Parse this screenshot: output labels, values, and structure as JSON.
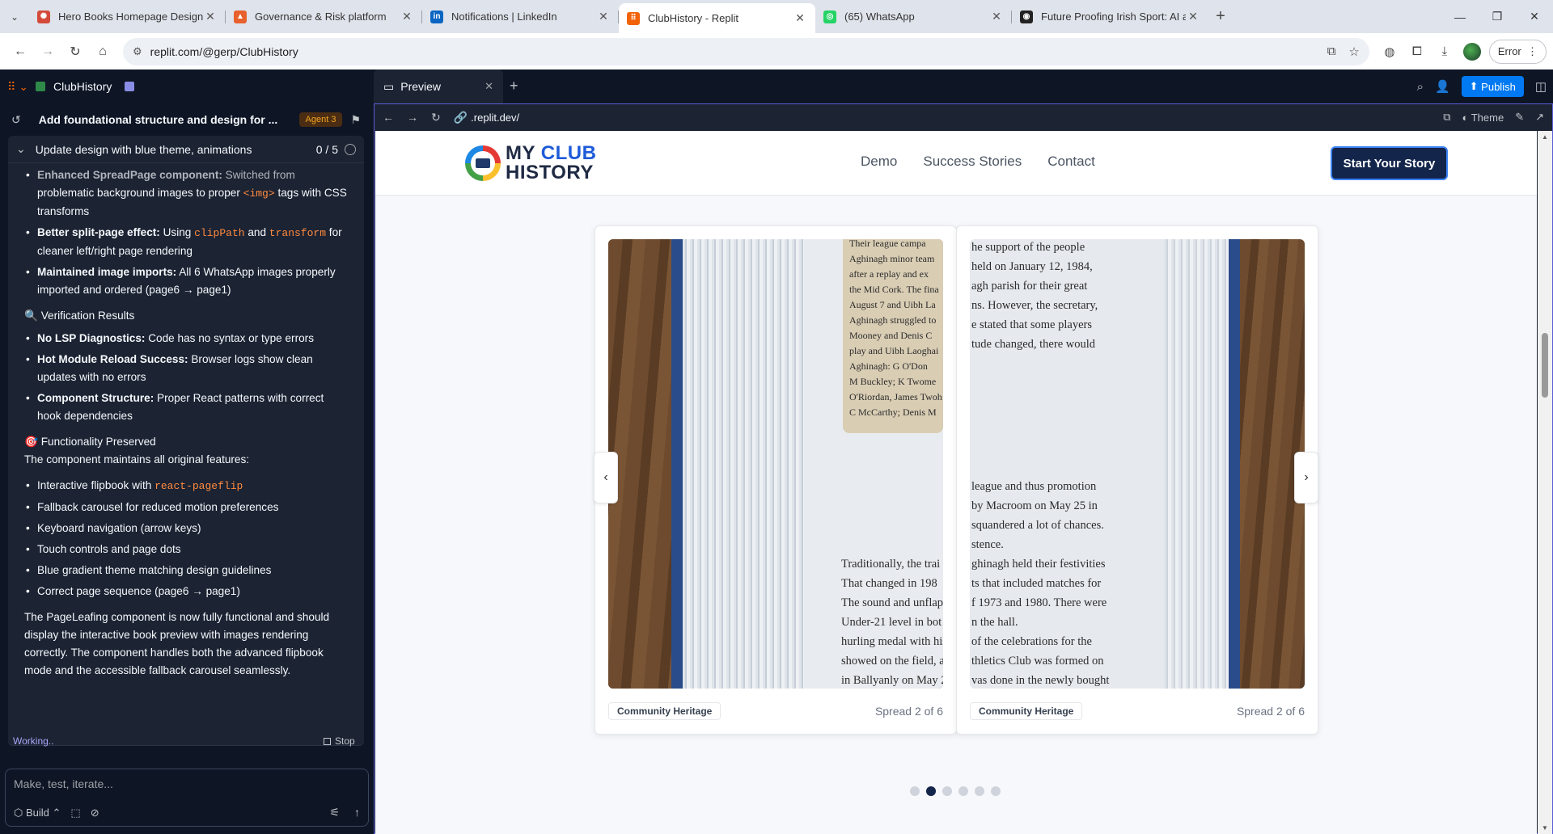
{
  "browser": {
    "tabs": [
      {
        "title": "Hero Books Homepage Design",
        "fav_color": "#d44a3a",
        "fav_glyph": "✺",
        "active": false
      },
      {
        "title": "Governance & Risk platform",
        "fav_color": "#e8612c",
        "fav_glyph": "▲",
        "active": false
      },
      {
        "title": "Notifications | LinkedIn",
        "fav_color": "#0a66c2",
        "fav_glyph": "in",
        "active": false
      },
      {
        "title": "ClubHistory - Replit",
        "fav_color": "#f26207",
        "fav_glyph": "⠿",
        "active": true
      },
      {
        "title": "(65) WhatsApp",
        "fav_color": "#25d366",
        "fav_glyph": "◎",
        "active": false
      },
      {
        "title": "Future Proofing Irish Sport: AI a",
        "fav_color": "#222222",
        "fav_glyph": "◉",
        "active": false
      }
    ],
    "url": "replit.com/@gerp/ClubHistory",
    "error_label": "Error"
  },
  "replit": {
    "project_name": "ClubHistory",
    "preview_tab": "Preview",
    "publish_label": "Publish",
    "agent": {
      "thread_title": "Add foundational structure and design for ...",
      "badge": "Agent 3",
      "task_title": "Update design with blue theme, animations",
      "task_count": "0 / 5",
      "messages": {
        "top_item_bold": "Enhanced SpreadPage component:",
        "top_item_text": " Switched from",
        "top_item_text2": "problematic background images to proper ",
        "top_item_code": "<img>",
        "top_item_text3": " tags with CSS transforms",
        "items1": [
          {
            "bold": "Better split-page effect:",
            "pre": " Using ",
            "code1": "clipPath",
            "mid": " and ",
            "code2": "transform",
            "post": " for cleaner left/right page rendering"
          },
          {
            "bold": "Maintained image imports:",
            "text": " All 6 WhatsApp images properly imported and ordered (page6 → page1)"
          }
        ],
        "verify_heading": "🔍 Verification Results",
        "items2": [
          {
            "bold": "No LSP Diagnostics:",
            "text": " Code has no syntax or type errors"
          },
          {
            "bold": "Hot Module Reload Success:",
            "text": " Browser logs show clean updates with no errors"
          },
          {
            "bold": "Component Structure:",
            "text": " Proper React patterns with correct hook dependencies"
          }
        ],
        "func_heading": "🎯 Functionality Preserved",
        "func_intro": "The component maintains all original features:",
        "feature_code_pre": "Interactive flipbook with ",
        "feature_code": "react-pageflip",
        "features": [
          "Fallback carousel for reduced motion preferences",
          "Keyboard navigation (arrow keys)",
          "Touch controls and page dots",
          "Blue gradient theme matching design guidelines",
          "Correct page sequence (page6 → page1)"
        ],
        "summary": "The PageLeafing component is now fully functional and should display the interactive book preview with images rendering correctly. The component handles both the advanced flipbook mode and the accessible fallback carousel seamlessly."
      },
      "status": "Working..",
      "stop_label": "Stop",
      "input_placeholder": "Make, test, iterate...",
      "build_label": "Build"
    },
    "preview": {
      "url": ".replit.dev/",
      "theme_label": "Theme"
    }
  },
  "site": {
    "logo": {
      "my": "MY",
      "club": "CLUB",
      "history": "HISTORY"
    },
    "nav": [
      "Demo",
      "Success Stories",
      "Contact"
    ],
    "cta": "Start Your Story",
    "left_card": {
      "tag": "Community Heritage",
      "spread": "Spread 2 of 6"
    },
    "right_card": {
      "tag": "Community Heritage",
      "spread": "Spread 2 of 6"
    },
    "dots_total": 6,
    "dots_active": 1,
    "left_clipping_lines": [
      "Their league campa",
      "Aghinagh minor team",
      "after a replay and ex",
      "the Mid Cork. The fina",
      "August 7 and Uibh La",
      "Aghinagh struggled to",
      "Mooney and Denis C",
      "play and Uibh Laoghai",
      "Aghinagh: G O'Don",
      "M Buckley; K Twome",
      "O'Riordan, James Twoh",
      "C McCarthy; Denis M"
    ],
    "left_page_lines": [
      "Traditionally, the trai",
      "That changed in 198",
      "The sound and unflap",
      "Under-21 level in bot",
      "hurling medal with his",
      "showed on the field, as",
      "in Ballyanly on May 2"
    ],
    "right_page_lines_top": [
      "he support of the people",
      "held on January 12, 1984,",
      "agh parish for their great",
      "ns. However, the secretary,",
      "e stated that some players",
      "tude changed, there would"
    ],
    "right_page_lines_bottom": [
      "league and thus promotion",
      "by Macroom on May 25 in",
      "squandered a lot of chances.",
      "stence.",
      "ghinagh held their festivities",
      "ts that included matches for",
      "f 1973 and 1980. There were",
      "n the hall.",
      "of the celebrations for the",
      "thletics Club was formed on",
      "vas done in the newly bought"
    ]
  }
}
